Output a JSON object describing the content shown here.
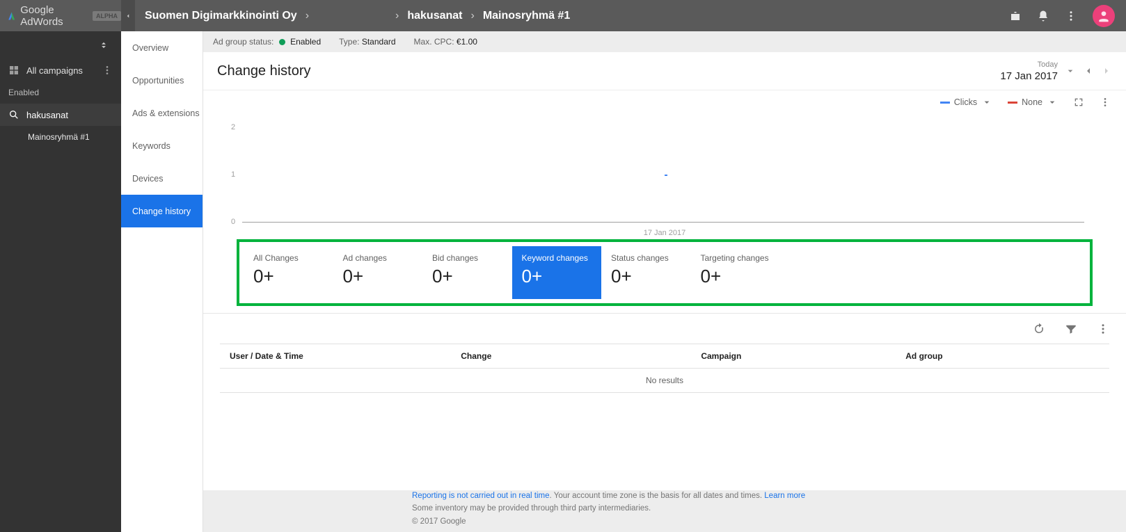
{
  "brand": {
    "name": "Google AdWords",
    "badge": "ALPHA"
  },
  "breadcrumbs": {
    "account": "Suomen Digimarkkinointi Oy",
    "campaign": "hakusanat",
    "adgroup": "Mainosryhmä #1"
  },
  "sidebar": {
    "all_campaigns": "All campaigns",
    "enabled": "Enabled",
    "campaign": "hakusanat",
    "adgroup": "Mainosryhmä #1"
  },
  "nav": {
    "items": [
      "Overview",
      "Opportunities",
      "Ads & extensions",
      "Keywords",
      "Devices",
      "Change history"
    ],
    "active_index": 5
  },
  "status_bar": {
    "adgroup_status_label": "Ad group status:",
    "adgroup_status_value": "Enabled",
    "type_label": "Type:",
    "type_value": "Standard",
    "maxcpc_label": "Max. CPC:",
    "maxcpc_value": "€1.00"
  },
  "page": {
    "title": "Change history",
    "date_pretext": "Today",
    "date_value": "17 Jan 2017"
  },
  "chart_controls": {
    "metric1": "Clicks",
    "metric2": "None"
  },
  "chart_data": {
    "type": "line",
    "x": [
      "17 Jan 2017"
    ],
    "series": [
      {
        "name": "Clicks",
        "values": [
          1
        ],
        "color": "#4285f4"
      }
    ],
    "y_ticks": [
      0,
      1,
      2
    ],
    "ylim": [
      0,
      2
    ],
    "xlabel": "",
    "ylabel": ""
  },
  "tiles": [
    {
      "label": "All Changes",
      "value": "0+"
    },
    {
      "label": "Ad changes",
      "value": "0+"
    },
    {
      "label": "Bid changes",
      "value": "0+"
    },
    {
      "label": "Keyword changes",
      "value": "0+"
    },
    {
      "label": "Status changes",
      "value": "0+"
    },
    {
      "label": "Targeting changes",
      "value": "0+"
    }
  ],
  "tiles_selected_index": 3,
  "table": {
    "columns": [
      "User / Date & Time",
      "Change",
      "Campaign",
      "Ad group"
    ],
    "no_results": "No results"
  },
  "footer": {
    "line1a": "Reporting is not carried out in real time",
    "line1b": ". Your account time zone is the basis for all dates and times. ",
    "learn_more": "Learn more",
    "line2": "Some inventory may be provided through third party intermediaries.",
    "copyright": "© 2017 Google"
  }
}
